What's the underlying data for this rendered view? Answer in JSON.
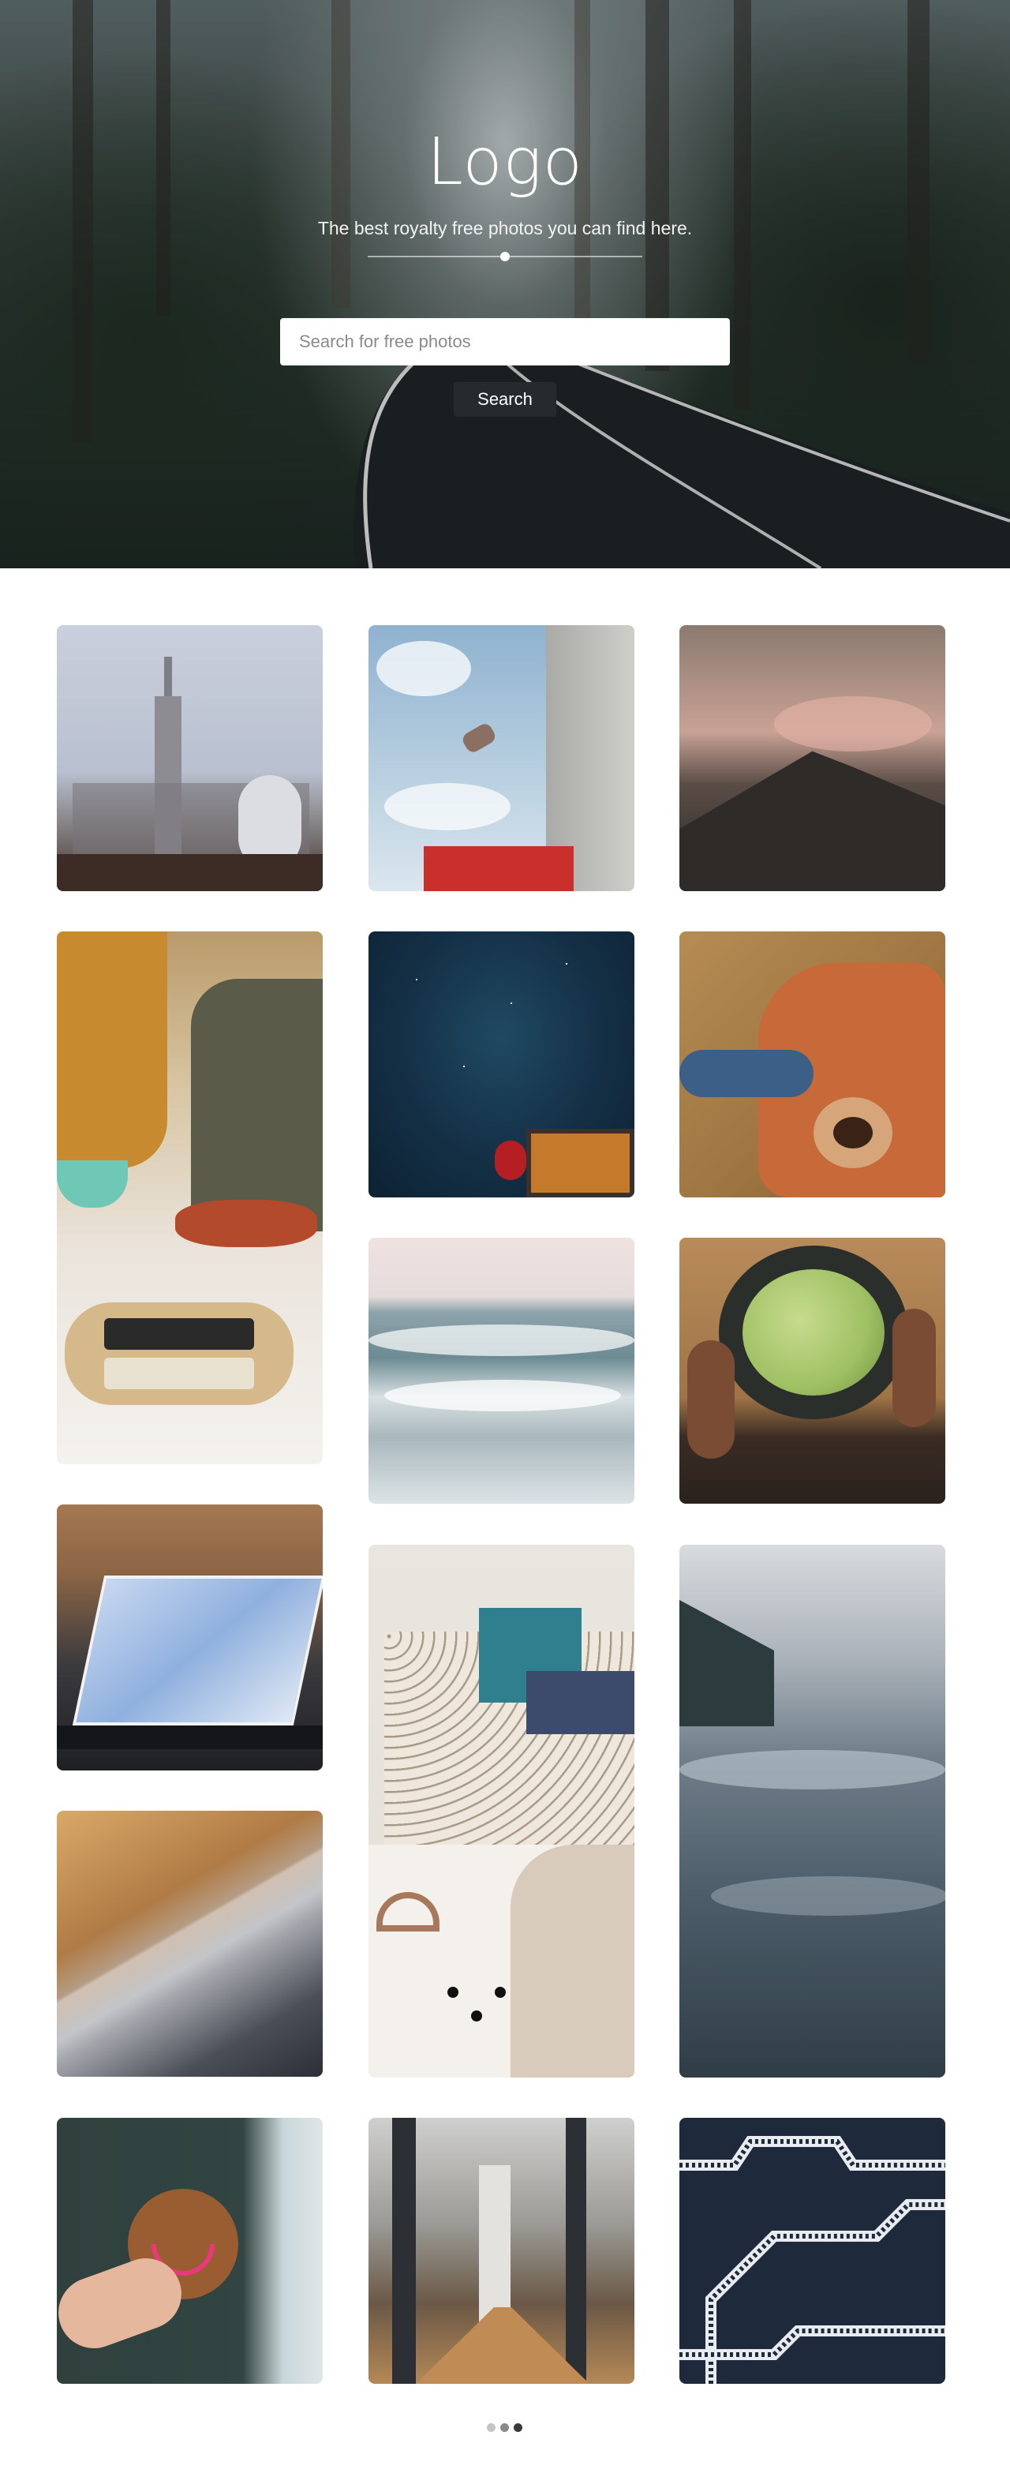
{
  "hero": {
    "logo": "Logo",
    "tagline": "The best royalty free photos you can find here.",
    "search_placeholder": "Search for free photos",
    "search_button": "Search"
  },
  "photos": [
    {
      "name": "photo-empire-state-building",
      "subject": "city skyline with binocular viewer"
    },
    {
      "name": "photo-person-jumping-sky",
      "subject": "person jumping against cloudy sky"
    },
    {
      "name": "photo-misty-mountain",
      "subject": "mountain peak with pink clouds"
    },
    {
      "name": "photo-cooking-sausage",
      "subject": "people cooking with sausage package"
    },
    {
      "name": "photo-starry-night",
      "subject": "starry night sky"
    },
    {
      "name": "photo-teddy-bear",
      "subject": "child holding teddy bear"
    },
    {
      "name": "photo-ocean-waves",
      "subject": "ocean waves"
    },
    {
      "name": "photo-green-apples",
      "subject": "hands holding bowl of green apples"
    },
    {
      "name": "photo-laptop",
      "subject": "tablet laptop with blue screen"
    },
    {
      "name": "photo-pegboard",
      "subject": "pegboard wall with books and decor"
    },
    {
      "name": "photo-misty-sea",
      "subject": "misty sea with trees"
    },
    {
      "name": "photo-architecture",
      "subject": "abstract architecture lines"
    },
    {
      "name": "photo-smiley-cookie",
      "subject": "hand holding smiley cookie"
    },
    {
      "name": "photo-office-hallway",
      "subject": "office hallway"
    },
    {
      "name": "photo-roads-aerial",
      "subject": "aerial winding roads"
    }
  ],
  "pagination": {
    "pages": 3,
    "current": 3
  },
  "colors": {
    "search_button_bg": "#252b2c",
    "dot_inactive": "#c4c4c4",
    "dot_mid": "#8a8a8a",
    "dot_active": "#3a3a3a"
  }
}
